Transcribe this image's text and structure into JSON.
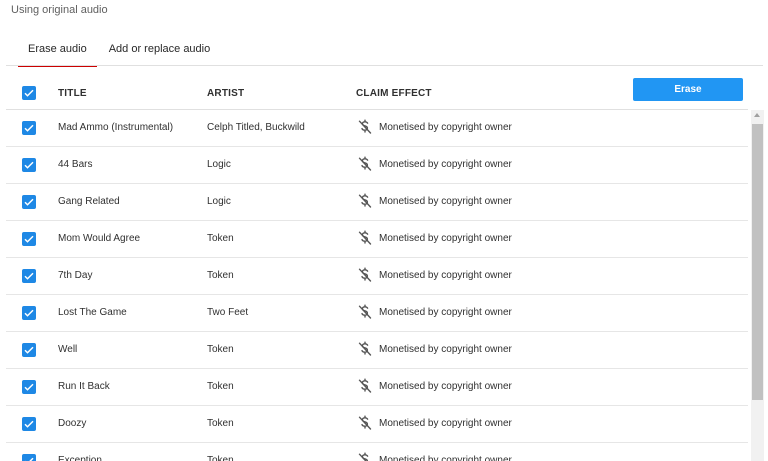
{
  "status_text": "Using original audio",
  "tabs": [
    {
      "label": "Erase audio",
      "active": true
    },
    {
      "label": "Add or replace audio",
      "active": false
    }
  ],
  "table": {
    "columns": {
      "title": "TITLE",
      "artist": "ARTIST",
      "claim": "CLAIM EFFECT"
    },
    "select_all_checked": true,
    "erase_button_label": "Erase",
    "rows": [
      {
        "title": "Mad Ammo (Instrumental)",
        "artist": "Celph Titled, Buckwild",
        "claim": "Monetised by copyright owner",
        "checked": true
      },
      {
        "title": "44 Bars",
        "artist": "Logic",
        "claim": "Monetised by copyright owner",
        "checked": true
      },
      {
        "title": "Gang Related",
        "artist": "Logic",
        "claim": "Monetised by copyright owner",
        "checked": true
      },
      {
        "title": "Mom Would Agree",
        "artist": "Token",
        "claim": "Monetised by copyright owner",
        "checked": true
      },
      {
        "title": "7th Day",
        "artist": "Token",
        "claim": "Monetised by copyright owner",
        "checked": true
      },
      {
        "title": "Lost The Game",
        "artist": "Two Feet",
        "claim": "Monetised by copyright owner",
        "checked": true
      },
      {
        "title": "Well",
        "artist": "Token",
        "claim": "Monetised by copyright owner",
        "checked": true
      },
      {
        "title": "Run It Back",
        "artist": "Token",
        "claim": "Monetised by copyright owner",
        "checked": true
      },
      {
        "title": "Doozy",
        "artist": "Token",
        "claim": "Monetised by copyright owner",
        "checked": true
      },
      {
        "title": "Exception",
        "artist": "Token",
        "claim": "Monetised by copyright owner",
        "checked": true
      }
    ]
  },
  "colors": {
    "accent": "#1e88e5",
    "tab_underline": "#cc0000",
    "button": "#2196f3"
  },
  "icons": {
    "checkbox": "checkmark-icon",
    "claim": "monetized-dollar-icon"
  }
}
